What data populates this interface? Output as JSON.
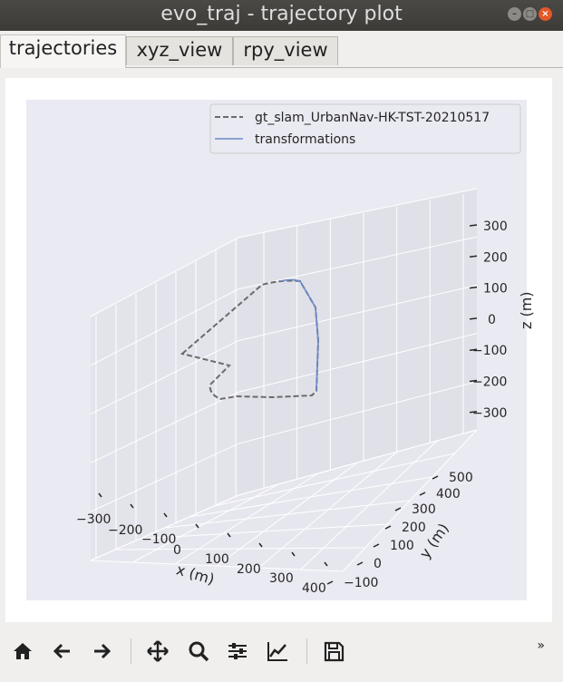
{
  "window": {
    "title": "evo_traj - trajectory plot"
  },
  "window_controls": {
    "minimize": "–",
    "maximize": "□",
    "close": "×"
  },
  "tabs": [
    {
      "label": "trajectories",
      "active": true
    },
    {
      "label": "xyz_view",
      "active": false
    },
    {
      "label": "rpy_view",
      "active": false
    }
  ],
  "toolbar": {
    "buttons": [
      {
        "name": "home",
        "icon": "home-icon"
      },
      {
        "name": "back",
        "icon": "arrow-left-icon"
      },
      {
        "name": "forward",
        "icon": "arrow-right-icon"
      },
      {
        "name": "pan",
        "icon": "move-icon"
      },
      {
        "name": "zoom",
        "icon": "search-icon"
      },
      {
        "name": "configure-subplots",
        "icon": "sliders-icon"
      },
      {
        "name": "edit-axis",
        "icon": "line-chart-icon"
      },
      {
        "name": "save",
        "icon": "save-icon"
      }
    ],
    "overflow_label": "»"
  },
  "chart_data": {
    "type": "line",
    "projection": "3d",
    "legend_location": "top-right",
    "grid": true,
    "series": [
      {
        "name": "gt_slam_UrbanNav-HK-TST-20210517",
        "style": "dashed",
        "color": "#6b6b6b"
      },
      {
        "name": "transformations",
        "style": "solid",
        "color": "#6a89c8"
      }
    ],
    "xlabel": "x (m)",
    "ylabel": "y (m)",
    "zlabel": "z (m)",
    "x_ticks": [
      "−300",
      "−200",
      "−100",
      "0",
      "100",
      "200",
      "300",
      "400"
    ],
    "y_ticks": [
      "−100",
      "0",
      "100",
      "200",
      "300",
      "400",
      "500"
    ],
    "z_ticks": [
      "300",
      "200",
      "100",
      "0",
      "−100",
      "−200",
      "−300"
    ],
    "colors": {
      "background": "#eaeaf2",
      "grid": "#ffffff"
    }
  }
}
